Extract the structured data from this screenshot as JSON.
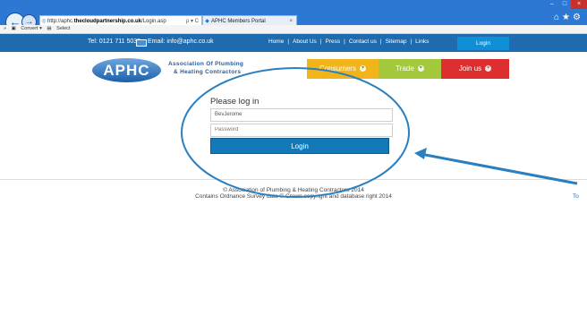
{
  "browser": {
    "address_prefix": "http://aphc.",
    "address_host": "thecloudpartnership.co.uk",
    "address_path": "/Login.asp",
    "address_controls": "ρ ▾ C",
    "tab_title": "APHC Members Portal",
    "tab_close": "×",
    "back_glyph": "←",
    "forward_glyph": "→",
    "window_minimize": "–",
    "window_maximize": "□",
    "window_close": "×",
    "home_icons": "⌂★⚙"
  },
  "toolbar": {
    "arrow": "»",
    "convert_label": "Convert",
    "select_label": "Select"
  },
  "topbar": {
    "phone": "Tel: 0121 711 5030",
    "email": "Email: info@aphc.co.uk",
    "nav": [
      "Home",
      "About Us",
      "Press",
      "Contact us",
      "Sitemap",
      "Links"
    ],
    "separator": "|",
    "login_tab": "Login"
  },
  "header": {
    "logo_text": "APHC",
    "logo_line1": "Association Of Plumbing",
    "logo_line2": "& Heating Contractors",
    "menu": [
      {
        "label": "Consumers",
        "color": "#f1b419"
      },
      {
        "label": "Trade",
        "color": "#a5c93c"
      },
      {
        "label": "Join us",
        "color": "#dd2f2f"
      }
    ],
    "menu_chevron": "▾"
  },
  "login": {
    "title": "Please log in",
    "username_value": "BevJerome",
    "password_placeholder": "Password",
    "button_label": "Login"
  },
  "footer": {
    "line1": "© Association of Plumbing & Heating Contractors 2014",
    "line2": "Contains Ordnance Survey data © Crown copyright and database right 2014",
    "to_top": "To"
  },
  "colors": {
    "annotation": "#2a7fc0",
    "site_blue": "#1f6bb0"
  }
}
